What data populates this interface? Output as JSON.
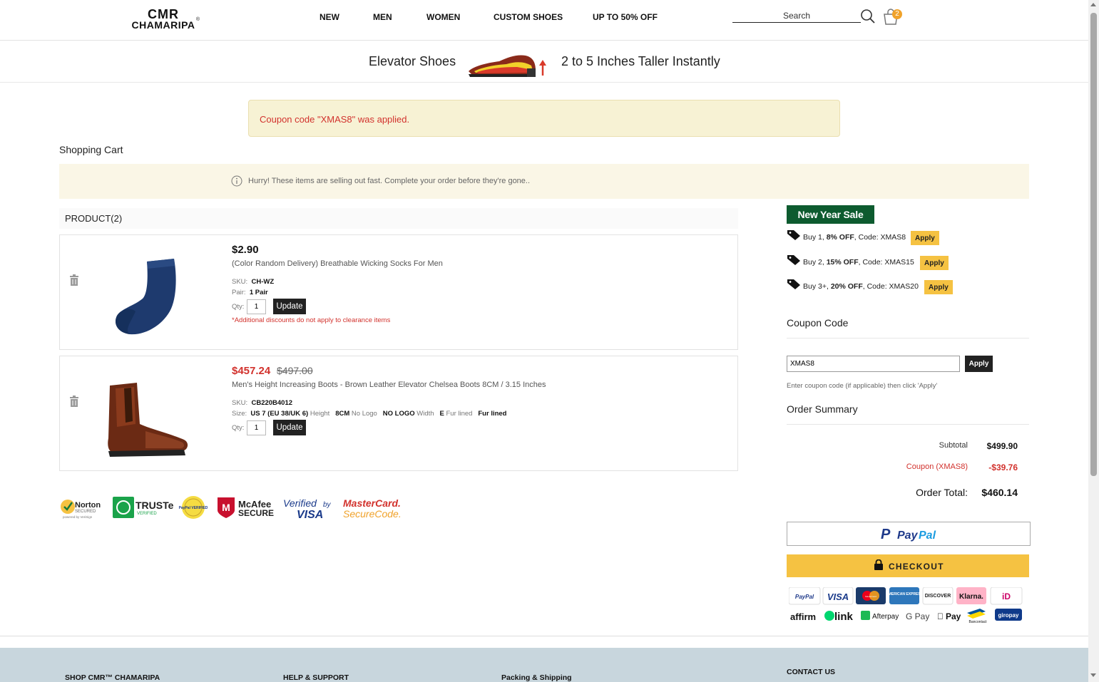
{
  "brand": {
    "line1": "CMR",
    "line2": "CHAMARIPA",
    "reg": "®"
  },
  "nav": {
    "items": [
      "NEW",
      "MEN",
      "WOMEN",
      "CUSTOM SHOES",
      "UP TO 50% OFF"
    ]
  },
  "search": {
    "placeholder": "Search"
  },
  "cart": {
    "count": "2"
  },
  "promo": {
    "left": "Elevator Shoes",
    "right": "2 to 5 Inches Taller Instantly"
  },
  "alert": {
    "message": "Coupon code \"XMAS8\" was applied."
  },
  "cart_title": "Shopping Cart",
  "hurry": {
    "message": "Hurry! These items are selling out fast. Complete your order before they're gone.."
  },
  "product_header": "PRODUCT(2)",
  "items": [
    {
      "price": "$2.90",
      "name": "(Color Random Delivery) Breathable Wicking Socks For Men",
      "sku_label": "SKU:",
      "sku": "CH-WZ",
      "pair_label": "Pair:",
      "pair": "1 Pair",
      "qty_label": "Qty:",
      "qty": "1",
      "update_label": "Update",
      "note": "*Additional discounts do not apply to clearance items"
    },
    {
      "price": "$457.24",
      "old_price": "$497.00",
      "name": "Men's Height Increasing Boots - Brown Leather Elevator Chelsea Boots 8CM / 3.15 Inches",
      "sku_label": "SKU:",
      "sku": "CB220B4012",
      "size_label": "Size:",
      "size": "US 7 (EU 38/UK 6)",
      "height_label": "Height",
      "height": "8CM",
      "logo_label": "No Logo",
      "logo": "NO LOGO",
      "width_label": "Width",
      "width": "E",
      "lined_label": "Fur lined",
      "lined": "Fur lined",
      "qty_label": "Qty:",
      "qty": "1",
      "update_label": "Update"
    }
  ],
  "trust": {
    "norton": "Norton",
    "norton_sub": "SECURED",
    "norton_by": "powered by VeriSign",
    "truste": "TRUSTe",
    "truste_sub": "VERIFIED",
    "paypal_seal": "PayPal VERIFIED",
    "mcafee": "McAfee",
    "mcafee_sub": "SECURE",
    "verified": "Verified",
    "by": "by",
    "visa": "VISA",
    "mastercard": "MasterCard.",
    "securecode": "SecureCode."
  },
  "sale": {
    "title": "New Year Sale",
    "deals": [
      {
        "pre": "Buy 1, ",
        "bold": "8% OFF",
        "post": ", Code: XMAS8",
        "apply": "Apply"
      },
      {
        "pre": "Buy 2, ",
        "bold": "15% OFF",
        "post": ", Code: XMAS15",
        "apply": "Apply"
      },
      {
        "pre": "Buy 3+, ",
        "bold": "20% OFF",
        "post": ", Code: XMAS20",
        "apply": "Apply"
      }
    ]
  },
  "coupon": {
    "title": "Coupon Code",
    "value": "XMAS8",
    "apply": "Apply",
    "help": "Enter coupon code (if applicable) then click 'Apply'"
  },
  "summary": {
    "title": "Order Summary",
    "subtotal_label": "Subtotal",
    "subtotal": "$499.90",
    "coupon_label": "Coupon (XMAS8)",
    "coupon": "-$39.76",
    "total_label": "Order Total:",
    "total": "$460.14"
  },
  "paypal_btn": {
    "p": "P",
    "label1": "Pay",
    "label2": "Pal"
  },
  "checkout": {
    "label": "CHECKOUT"
  },
  "payment_methods": [
    "PayPal",
    "VISA",
    "MasterCard",
    "AMERICAN EXPRESS",
    "DISCOVER",
    "Klarna.",
    "iD",
    "affirm",
    "link",
    "Afterpay",
    "G Pay",
    "Pay",
    "Bancontact",
    "giropay"
  ],
  "footer": {
    "col1": "SHOP CMR™ CHAMARIPA",
    "col2": "HELP & SUPPORT",
    "col3": "Packing & Shipping",
    "col4": "CONTACT US"
  },
  "colors": {
    "accent": "#f5c242",
    "sale_green": "#0d5b2f",
    "error_red": "#d2322d",
    "footer_bg": "#c8d6dd"
  }
}
